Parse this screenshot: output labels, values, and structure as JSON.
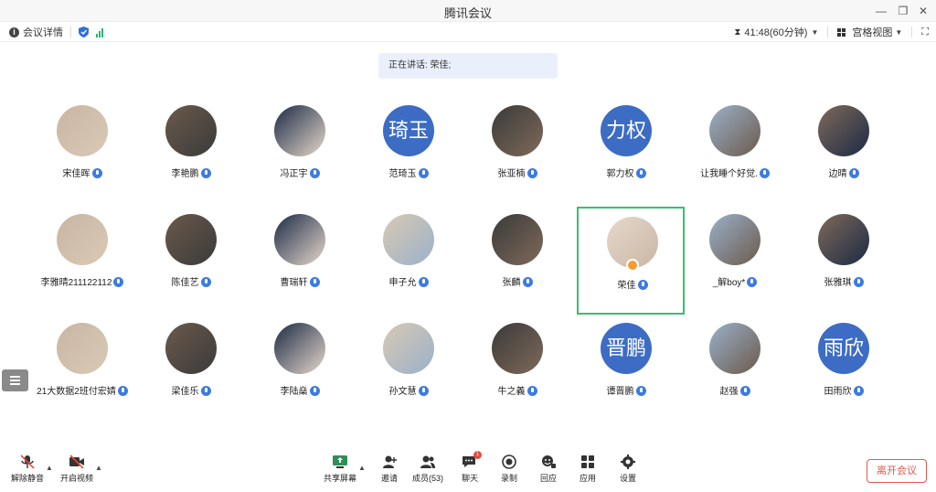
{
  "window": {
    "title": "腾讯会议"
  },
  "infobar": {
    "meeting_details": "会议详情",
    "timer": "41:48(60分钟)",
    "view_mode": "宫格视图"
  },
  "speaking_banner": "正在讲话: 荣佳;",
  "participants": [
    {
      "name": "宋佳晖",
      "avatar": "photo"
    },
    {
      "name": "李艳鹏",
      "avatar": "photo"
    },
    {
      "name": "冯正宇",
      "avatar": "photo"
    },
    {
      "name": "范琦玉",
      "avatar": "text",
      "avatar_text": "琦玉"
    },
    {
      "name": "张亚楠",
      "avatar": "photo"
    },
    {
      "name": "郭力权",
      "avatar": "text",
      "avatar_text": "力权"
    },
    {
      "name": "让我睡个好觉.",
      "avatar": "photo"
    },
    {
      "name": "边晴",
      "avatar": "photo"
    },
    {
      "name": "李雅晴211122112",
      "avatar": "photo"
    },
    {
      "name": "陈佳艺",
      "avatar": "photo"
    },
    {
      "name": "曹瑞轩",
      "avatar": "photo"
    },
    {
      "name": "申子允",
      "avatar": "photo"
    },
    {
      "name": "张麟",
      "avatar": "photo"
    },
    {
      "name": "荣佳",
      "avatar": "photo",
      "speaking": true
    },
    {
      "name": "_解boy*",
      "avatar": "photo"
    },
    {
      "name": "张雅琪",
      "avatar": "photo"
    },
    {
      "name": "21大数据2班付宏婧",
      "avatar": "photo"
    },
    {
      "name": "梁佳乐",
      "avatar": "photo"
    },
    {
      "name": "李陆燊",
      "avatar": "photo"
    },
    {
      "name": "孙文慧",
      "avatar": "photo"
    },
    {
      "name": "牛之義",
      "avatar": "photo"
    },
    {
      "name": "谭晋鹏",
      "avatar": "text",
      "avatar_text": "晋鹏"
    },
    {
      "name": "赵强",
      "avatar": "photo"
    },
    {
      "name": "田雨欣",
      "avatar": "text",
      "avatar_text": "雨欣"
    }
  ],
  "toolbar": {
    "unmute": "解除静音",
    "start_video": "开启视频",
    "share_screen": "共享屏幕",
    "invite": "邀请",
    "members": "成员(53)",
    "chat": "聊天",
    "chat_badge": "1",
    "record": "录制",
    "playback": "回应",
    "apps": "应用",
    "settings": "设置",
    "leave": "离开会议"
  },
  "colors": {
    "accent_blue": "#3c6cc4",
    "active_border": "#3bbf6e",
    "leave_red": "#e05a4b"
  }
}
